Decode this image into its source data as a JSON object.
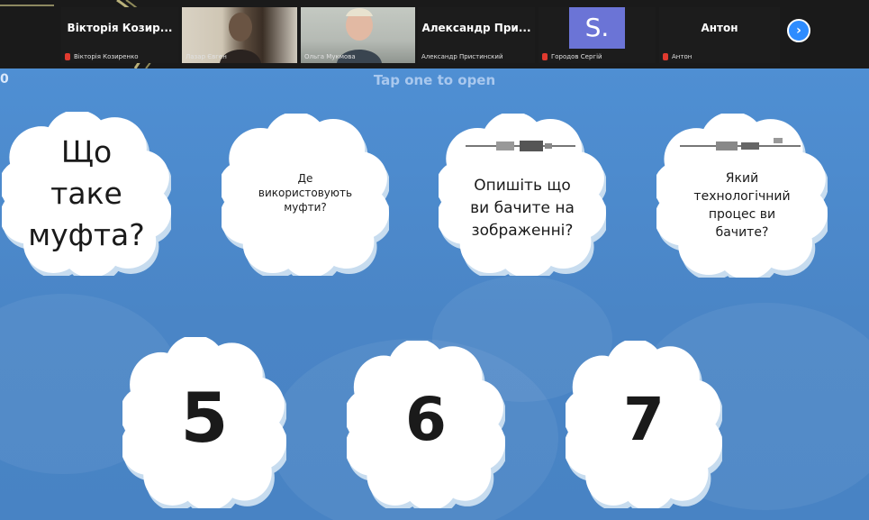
{
  "participants": {
    "tile1": {
      "name": "Вікторія Козир...",
      "label": "Вікторія Козиренко"
    },
    "tile2": {
      "label": "Лазар Євген"
    },
    "tile3": {
      "label": "Ольга Мукмова"
    },
    "tile4": {
      "name": "Александр При...",
      "label": "Александр Пристинский"
    },
    "tile5": {
      "avatar_letter": "S.",
      "label": "Городов Сергій"
    },
    "tile6": {
      "name": "Антон",
      "label": "Антон"
    }
  },
  "colors": {
    "mic_muted": "#e03a2f",
    "avatar_tile": "#6b74d6",
    "next_button": "#2d8cff",
    "game_background": "#4a86c8"
  },
  "icons": {
    "mic": "mic-muted-icon",
    "next": "chevron-right-icon"
  },
  "game": {
    "counter": "0",
    "instruction": "Tap one to open",
    "cards": [
      {
        "text": "Що\nтаке\nмуфта?"
      },
      {
        "text": "Де\nвикористовують\nмуфти?"
      },
      {
        "text": "Опишіть що\nви бачите на\nзображенні?"
      },
      {
        "text": "Який\nтехнологічний\nпроцес ви\nбачите?"
      },
      {
        "text": "5"
      },
      {
        "text": "6"
      },
      {
        "text": "7"
      }
    ]
  }
}
